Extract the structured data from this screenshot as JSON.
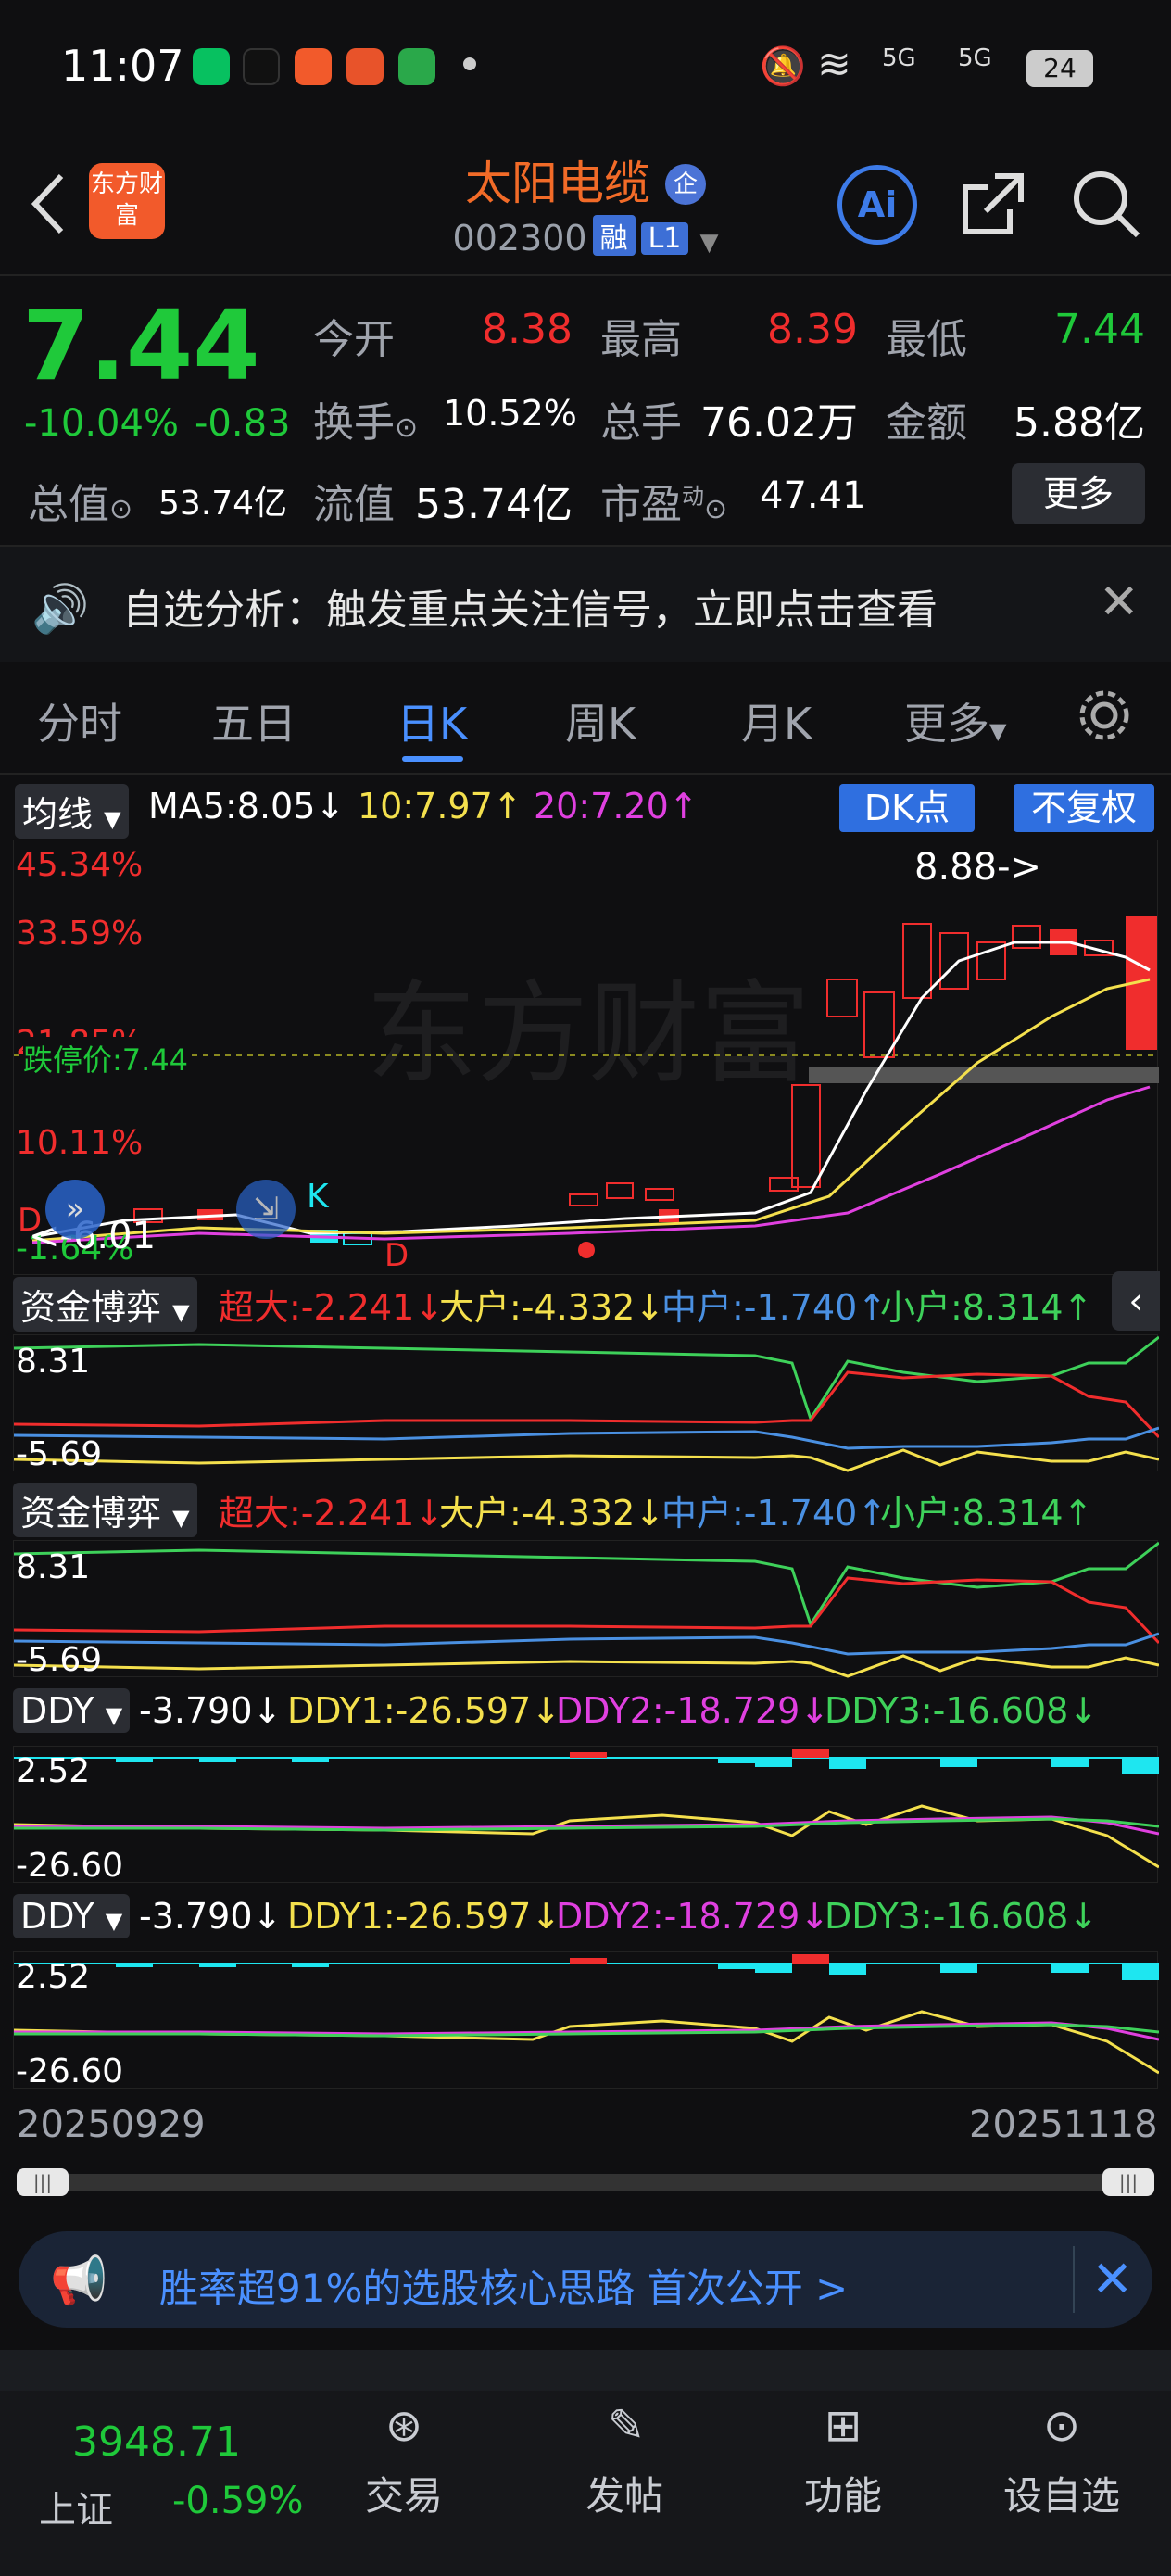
{
  "status_bar": {
    "time": "11:07",
    "signal1": "5G",
    "signal2": "5G",
    "battery": "24"
  },
  "header": {
    "title": "太阳电缆",
    "title_badge": "企",
    "code": "002300",
    "tag_rong": "融",
    "tag_level": "L1",
    "logo_text": "东方财富"
  },
  "quote": {
    "price": "7.44",
    "change_pct": "-10.04%",
    "change_amt": "-0.83",
    "labels": {
      "open": "今开",
      "high": "最高",
      "low": "最低",
      "turnover": "换手",
      "volume": "总手",
      "amount": "金额",
      "total_mv": "总值",
      "float_mv": "流值",
      "pe": "市盈",
      "pe_sup": "动"
    },
    "open": "8.38",
    "high": "8.39",
    "low": "7.44",
    "turnover": "10.52%",
    "volume": "76.02万",
    "amount": "5.88亿",
    "total_mv": "53.74亿",
    "float_mv": "53.74亿",
    "pe": "47.41",
    "more_button": "更多"
  },
  "notice": {
    "text": "自选分析：触发重点关注信号，立即点击查看"
  },
  "tabs": [
    "分时",
    "五日",
    "日K",
    "周K",
    "月K",
    "更多"
  ],
  "active_tab": "日K",
  "ma_bar": {
    "select": "均线",
    "ma5": "MA5:8.05",
    "ma10": "10:7.97",
    "ma20": "20:7.20",
    "dk_button": "DK点",
    "adjust_button": "不复权"
  },
  "kline": {
    "left_labels": [
      "45.34%",
      "33.59%",
      "21.85%",
      "10.11%",
      "-1.64%"
    ],
    "limit_down_label": "跌停价:7.44",
    "high_marker": "8.88->",
    "low_marker": "<-6.01",
    "marker_k": "K",
    "marker_d1": "D",
    "marker_d2": "D",
    "watermark": "东方财富"
  },
  "fund_panel": {
    "select": "资金博弈",
    "super": "超大:-2.241",
    "large": "大户:-4.332",
    "mid": "中户:-1.740",
    "small": "小户:8.314",
    "max": "8.31",
    "min": "-5.69"
  },
  "ddy_panel": {
    "select": "DDY",
    "ddy": "-3.790",
    "ddy1": "DDY1:-26.597",
    "ddy2": "DDY2:-18.729",
    "ddy3": "DDY3:-16.608",
    "max": "2.52",
    "min": "-26.60"
  },
  "date_range": {
    "start": "20250929",
    "end": "20251118"
  },
  "ad_banner": {
    "text": "胜率超91%的选股核心思路 首次公开 >"
  },
  "bottom": {
    "index_value": "3948.71",
    "index_name": "上证",
    "index_change": "-0.59%",
    "nav": [
      "交易",
      "发帖",
      "功能",
      "设自选"
    ]
  },
  "colors": {
    "up": "#f02d2d",
    "down": "#1fc93a",
    "accent": "#4a90ff",
    "brand": "#f26b28"
  }
}
